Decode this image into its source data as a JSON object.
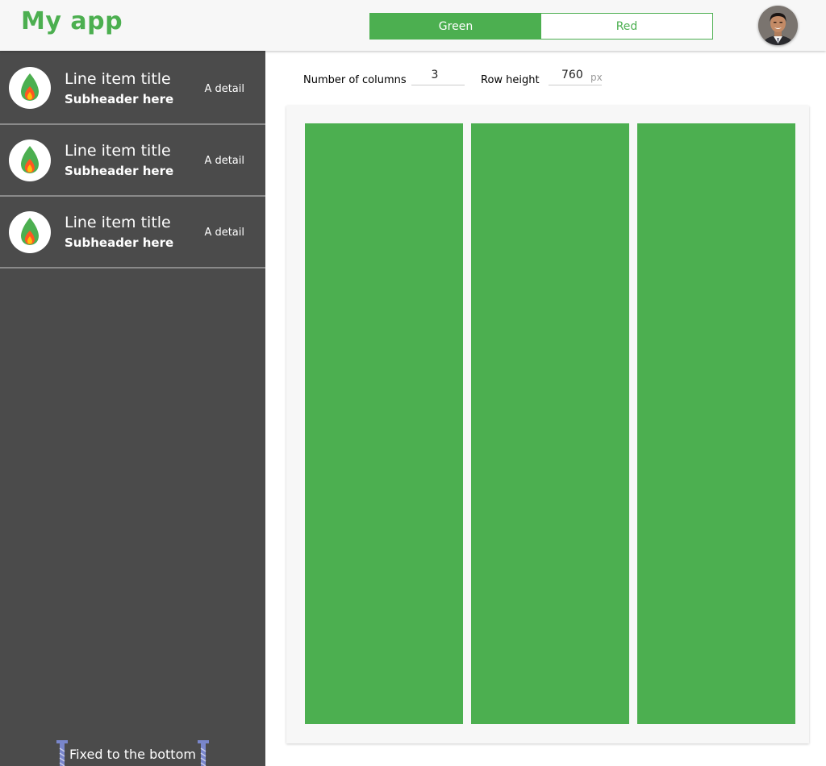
{
  "app": {
    "title": "My app"
  },
  "header": {
    "toggle": {
      "options": [
        "Green",
        "Red"
      ],
      "selected": "Green"
    }
  },
  "sidebar": {
    "items": [
      {
        "title": "Line item title",
        "subheader": "Subheader here",
        "detail": "A detail",
        "icon": "fire-icon"
      },
      {
        "title": "Line item title",
        "subheader": "Subheader here",
        "detail": "A detail",
        "icon": "fire-icon"
      },
      {
        "title": "Line item title",
        "subheader": "Subheader here",
        "detail": "A detail",
        "icon": "fire-icon"
      }
    ],
    "footer_text": "Fixed to the bottom",
    "footer_icon": "pin-icon"
  },
  "controls": {
    "columns_label": "Number of columns",
    "columns_value": "3",
    "row_height_label": "Row height",
    "row_height_value": "760",
    "row_height_unit": "px"
  },
  "grid": {
    "columns": 3
  },
  "colors": {
    "accent": "#4caf50",
    "sidebar_bg": "#4b4b4b",
    "header_bg": "#f7f7f7",
    "card_bg": "#f7f7f7",
    "fire_outer": "#ff5722",
    "fire_inner": "#ffc107"
  }
}
